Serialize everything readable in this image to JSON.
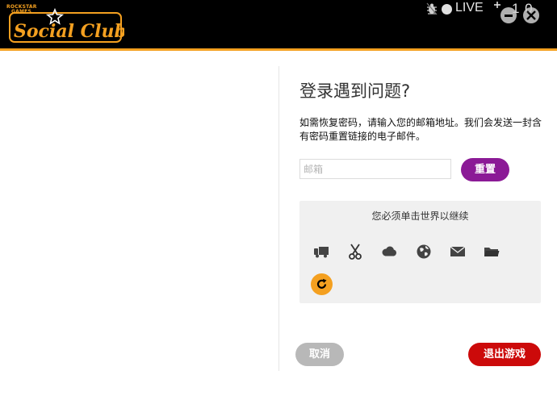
{
  "header": {
    "logo": {
      "brand_line1": "ROCKSTAR",
      "brand_line2": "GAMES",
      "wordmark": "Social Club"
    },
    "status": {
      "live_label": "LIVE",
      "friends_count": "1 0"
    },
    "icons": {
      "bug": "bug-icon",
      "friends": "friends-icon",
      "minimize": "minimize-icon",
      "close": "close-icon"
    }
  },
  "form": {
    "title": "登录遇到问题?",
    "description": "如需恢复密码，请输入您的邮箱地址。我们会发送一封含有密码重置链接的电子邮件。",
    "email_placeholder": "邮箱",
    "email_value": "",
    "reset_label": "重置"
  },
  "captcha": {
    "instruction": "您必须单击世界以继续",
    "icons": [
      "truck-icon",
      "scissors-icon",
      "cloud-icon",
      "globe-icon",
      "envelope-icon",
      "folder-icon"
    ],
    "refresh_icon": "refresh-icon"
  },
  "actions": {
    "cancel_label": "取消",
    "quit_label": "退出游戏"
  },
  "colors": {
    "accent_orange": "#f4a020",
    "reset_purple": "#8b1a96",
    "quit_red": "#cc0a0a",
    "cancel_gray": "#b8b8b8",
    "header_black": "#000000"
  }
}
